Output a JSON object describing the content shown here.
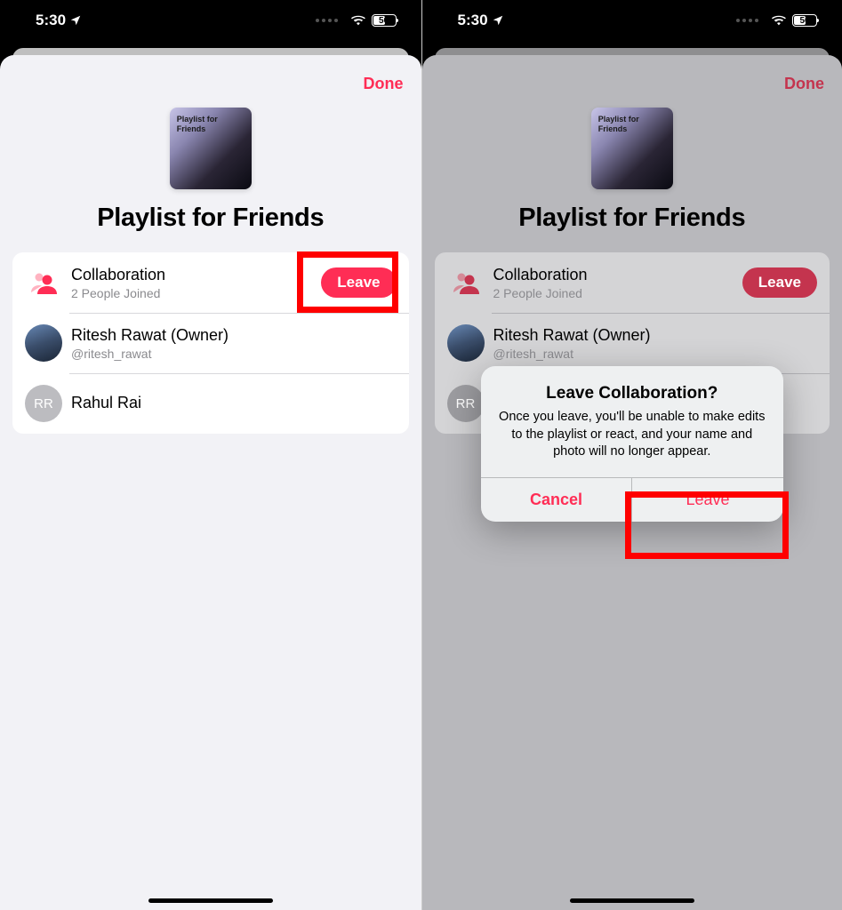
{
  "statusBar": {
    "time": "5:30",
    "battery": "50"
  },
  "nav": {
    "done": "Done"
  },
  "playlist": {
    "artworkLabel": "Playlist for\nFriends",
    "title": "Playlist for Friends"
  },
  "collab": {
    "title": "Collaboration",
    "subtitle": "2 People Joined",
    "leaveLabel": "Leave"
  },
  "members": [
    {
      "name": "Ritesh Rawat (Owner)",
      "handle": "@ritesh_rawat",
      "initials": "",
      "hasPhoto": true
    },
    {
      "name": "Rahul Rai",
      "handle": "",
      "initials": "RR",
      "hasPhoto": false
    }
  ],
  "alert": {
    "title": "Leave Collaboration?",
    "message": "Once you leave, you'll be unable to make edits to the playlist or react, and your name and photo will no longer appear.",
    "cancel": "Cancel",
    "confirm": "Leave"
  }
}
